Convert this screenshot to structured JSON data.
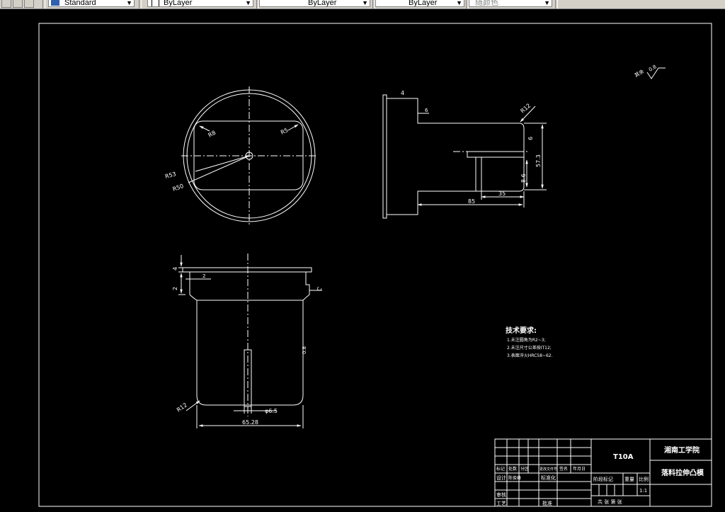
{
  "toolbar": {
    "text_style": "Standard",
    "layer_color": "ByLayer",
    "linetype": "ByLayer",
    "lineweight": "ByLayer",
    "plot_style": "随颜色"
  },
  "drawing": {
    "radius_r8": "R8",
    "radius_r5": "R5",
    "radius_r53": "R53",
    "radius_r50": "R50",
    "right_r12": "R12",
    "right_height": "57.3",
    "right_small_dim": "8.6",
    "right_dim_35": "35",
    "right_dim_85": "85",
    "right_slot": "6",
    "right_top_mark": "4",
    "roughness_note": "其余",
    "roughness_value": "0.8",
    "bottom_dim_width": "65.28",
    "bottom_dim_slot": "φ6.5",
    "bottom_r12": "R12",
    "bottom_dim_4": "4",
    "bottom_dim_2": "2",
    "bottom_dim_2b": "2",
    "bottom_dim_c": "C",
    "bottom_dim_08": "0.8",
    "tech_title": "技术要求:",
    "tech_items": [
      "1.未注圆角为R2~3;",
      "2.未注尺寸公差按IT12;",
      "3.表面淬火HRC58~62."
    ]
  },
  "title_block": {
    "material": "T10A",
    "school": "湘南工学院",
    "part_name": "落料拉伸凸模",
    "scale_label": "比例",
    "scale_value": "1:1",
    "stage_headers": [
      "阶段标记",
      "重量"
    ],
    "sheet_text": "共 张 第 张",
    "rev_headers": [
      "标记",
      "处数",
      "分区",
      "更改文件号",
      "签名",
      "年月日"
    ],
    "roles": [
      "设计",
      "审核",
      "工艺"
    ],
    "designer": "陈俊峰",
    "standardize": "标准化",
    "approve": "批准"
  }
}
